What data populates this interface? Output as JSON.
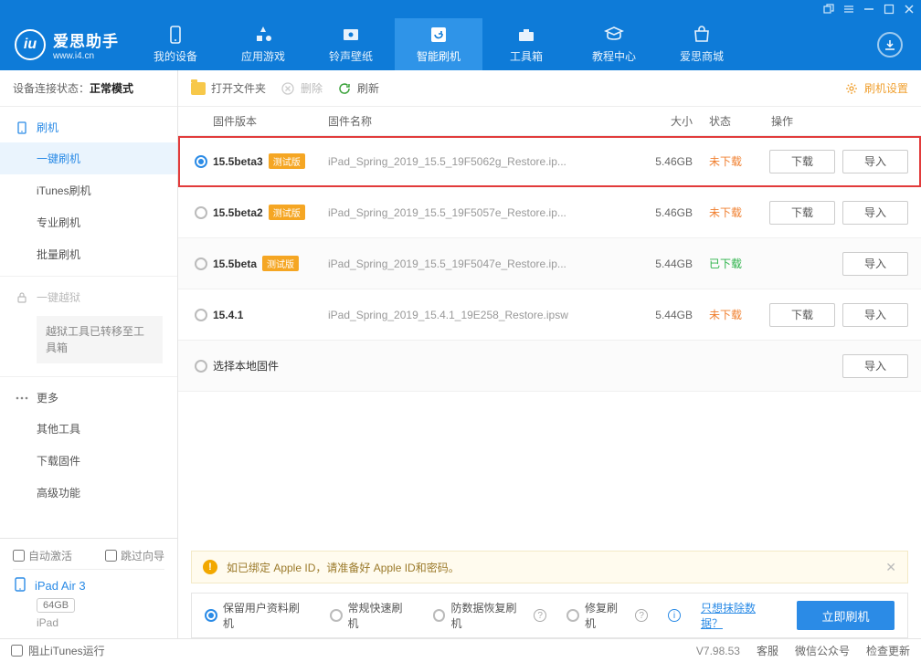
{
  "brand": {
    "name": "爱思助手",
    "site": "www.i4.cn",
    "logo_text": "iu"
  },
  "nav": {
    "items": [
      {
        "id": "device",
        "label": "我的设备"
      },
      {
        "id": "apps",
        "label": "应用游戏"
      },
      {
        "id": "ringtones",
        "label": "铃声壁纸"
      },
      {
        "id": "flash",
        "label": "智能刷机"
      },
      {
        "id": "toolbox",
        "label": "工具箱"
      },
      {
        "id": "tutorials",
        "label": "教程中心"
      },
      {
        "id": "store",
        "label": "爱思商城"
      }
    ],
    "active_id": "flash"
  },
  "connection": {
    "label": "设备连接状态：",
    "value": "正常模式"
  },
  "sidebar": {
    "flash_header": "刷机",
    "flash_items": [
      {
        "id": "oneclick",
        "label": "一键刷机",
        "active": true
      },
      {
        "id": "itunes",
        "label": "iTunes刷机"
      },
      {
        "id": "pro",
        "label": "专业刷机"
      },
      {
        "id": "batch",
        "label": "批量刷机"
      }
    ],
    "jailbreak_header": "一键越狱",
    "jailbreak_note": "越狱工具已转移至工具箱",
    "more_header": "更多",
    "more_items": [
      {
        "id": "other",
        "label": "其他工具"
      },
      {
        "id": "download",
        "label": "下载固件"
      },
      {
        "id": "advanced",
        "label": "高级功能"
      }
    ]
  },
  "device_panel": {
    "auto_activate": "自动激活",
    "skip_guide": "跳过向导",
    "device_name": "iPad Air 3",
    "capacity": "64GB",
    "type": "iPad"
  },
  "toolbar": {
    "open_folder": "打开文件夹",
    "delete": "删除",
    "refresh": "刷新",
    "settings": "刷机设置"
  },
  "columns": {
    "version": "固件版本",
    "name": "固件名称",
    "size": "大小",
    "status": "状态",
    "ops": "操作"
  },
  "badge_text": "测试版",
  "buttons": {
    "download": "下载",
    "import": "导入"
  },
  "status_text": {
    "not": "未下载",
    "done": "已下载"
  },
  "local_firmware_label": "选择本地固件",
  "firmware": [
    {
      "version": "15.5beta3",
      "beta": true,
      "filename": "iPad_Spring_2019_15.5_19F5062g_Restore.ip...",
      "size": "5.46GB",
      "status": "not",
      "selected": true,
      "highlight": true
    },
    {
      "version": "15.5beta2",
      "beta": true,
      "filename": "iPad_Spring_2019_15.5_19F5057e_Restore.ip...",
      "size": "5.46GB",
      "status": "not",
      "selected": false
    },
    {
      "version": "15.5beta",
      "beta": true,
      "filename": "iPad_Spring_2019_15.5_19F5047e_Restore.ip...",
      "size": "5.44GB",
      "status": "done",
      "selected": false
    },
    {
      "version": "15.4.1",
      "beta": false,
      "filename": "iPad_Spring_2019_15.4.1_19E258_Restore.ipsw",
      "size": "5.44GB",
      "status": "not",
      "selected": false
    }
  ],
  "notice": "如已绑定 Apple ID，请准备好 Apple ID和密码。",
  "flash_options": [
    {
      "id": "keep",
      "label": "保留用户资料刷机",
      "checked": true,
      "help": false
    },
    {
      "id": "normal",
      "label": "常规快速刷机",
      "checked": false,
      "help": false
    },
    {
      "id": "antirecover",
      "label": "防数据恢复刷机",
      "checked": false,
      "help": true
    },
    {
      "id": "repair",
      "label": "修复刷机",
      "checked": false,
      "help": true
    }
  ],
  "erase_link": "只想抹除数据？",
  "flash_now": "立即刷机",
  "footer": {
    "block_itunes": "阻止iTunes运行",
    "version": "V7.98.53",
    "support": "客服",
    "wechat": "微信公众号",
    "check_update": "检查更新"
  }
}
